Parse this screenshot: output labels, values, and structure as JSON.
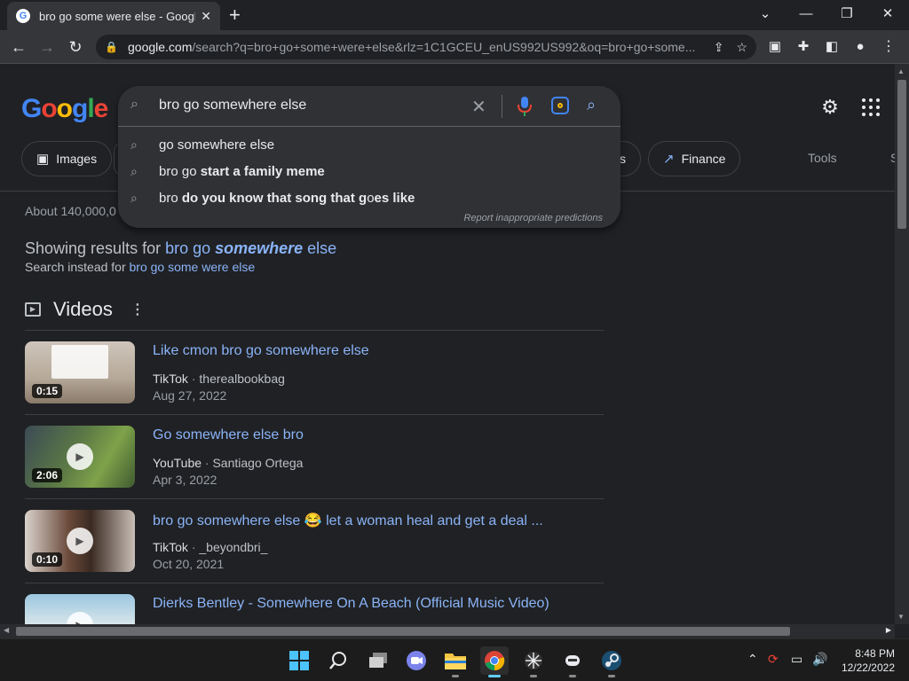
{
  "browser": {
    "tab_title": "bro go some were else - Google",
    "url_host": "google.com",
    "url_path": "/search?q=bro+go+some+were+else&rlz=1C1GCEU_enUS992US992&oq=bro+go+some..."
  },
  "google": {
    "logo_letters": [
      "G",
      "o",
      "o",
      "g",
      "l",
      "e"
    ]
  },
  "search": {
    "query": "bro go somewhere else",
    "suggestions": [
      {
        "plain": "go somewhere else",
        "bold": ""
      },
      {
        "plain": "bro go ",
        "bold": "start a family meme"
      },
      {
        "plain": "bro ",
        "bold": "do you know that song that g",
        "plain2": "o",
        "bold2": "es like"
      }
    ],
    "report_text": "Report inappropriate predictions"
  },
  "chips": {
    "images": "Images",
    "partial": "s",
    "finance": "Finance",
    "tools": "Tools",
    "cut": "S"
  },
  "results": {
    "stats": "About 140,000,0",
    "showing_prefix": "Showing results for ",
    "showing_plain1": "bro go ",
    "showing_bold": "somewhere",
    "showing_plain2": " else",
    "instead_prefix": "Search instead for ",
    "instead_link": "bro go some were else"
  },
  "videos": {
    "heading": "Videos",
    "items": [
      {
        "title": "Like cmon bro go somewhere else",
        "source": "TikTok",
        "channel": "therealbookbag",
        "date": "Aug 27, 2022",
        "duration": "0:15"
      },
      {
        "title": "Go somewhere else bro",
        "source": "YouTube",
        "channel": "Santiago Ortega",
        "date": "Apr 3, 2022",
        "duration": "2:06"
      },
      {
        "title": "bro go somewhere else 😂 let a woman heal and get a deal ...",
        "source": "TikTok",
        "channel": "_beyondbri_",
        "date": "Oct 20, 2021",
        "duration": "0:10"
      },
      {
        "title": "Dierks Bentley - Somewhere On A Beach (Official Music Video)",
        "source": "",
        "channel": "",
        "date": "",
        "duration": ""
      }
    ]
  },
  "taskbar": {
    "time": "8:48 PM",
    "date": "12/22/2022"
  },
  "colors": {
    "link": "#8ab4f8",
    "background": "#202124",
    "chrome": "#35363a"
  }
}
